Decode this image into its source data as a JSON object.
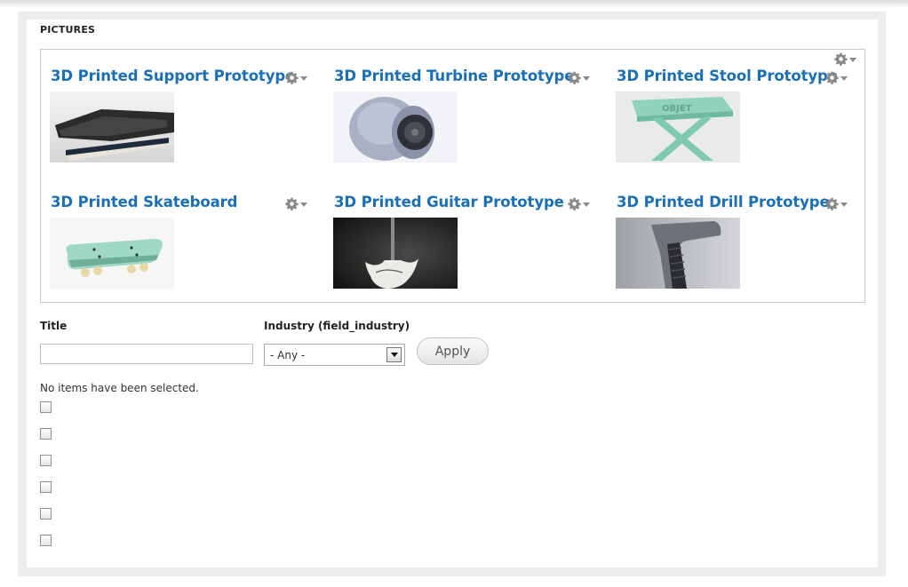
{
  "section": {
    "title": "PICTURES"
  },
  "gallery": {
    "items": [
      {
        "title": "3D Printed Support Prototype",
        "image": "keyboard-wrist-rest-photo"
      },
      {
        "title": "3D Printed Turbine Prototype",
        "image": "turbine-photo"
      },
      {
        "title": "3D Printed Stool Prototype",
        "image": "stool-photo"
      },
      {
        "title": "3D Printed Skateboard",
        "image": "skateboard-photo"
      },
      {
        "title": "3D Printed Guitar Prototype",
        "image": "guitar-photo"
      },
      {
        "title": "3D Printed Drill Prototype",
        "image": "drill-photo"
      }
    ],
    "gear_icon": "gear-icon",
    "link_color": "#1a6fb5"
  },
  "filters": {
    "title_label": "Title",
    "title_value": "",
    "industry_label": "Industry (field_industry)",
    "industry_selected": "- Any -",
    "apply_label": "Apply"
  },
  "bulk": {
    "status": "No items have been selected.",
    "checkbox_count": 6
  }
}
